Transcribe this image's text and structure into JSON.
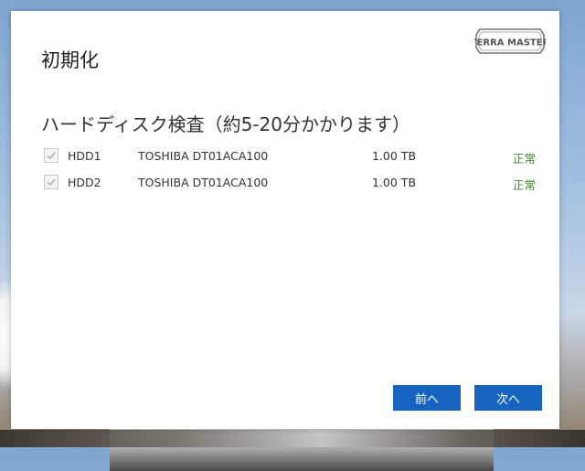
{
  "dialog": {
    "title": "初期化",
    "logo_text": "TERRA MASTER",
    "subtitle": "ハードディスク検査（約5-20分かかります）"
  },
  "disks": [
    {
      "name": "HDD1",
      "model": "TOSHIBA DT01ACA100",
      "size": "1.00 TB",
      "status": "正常",
      "checked": true
    },
    {
      "name": "HDD2",
      "model": "TOSHIBA DT01ACA100",
      "size": "1.00 TB",
      "status": "正常",
      "checked": true
    }
  ],
  "buttons": {
    "prev_label": "前へ",
    "next_label": "次へ"
  },
  "colors": {
    "accent": "#1565c0",
    "status_ok": "#3a8a2a"
  }
}
